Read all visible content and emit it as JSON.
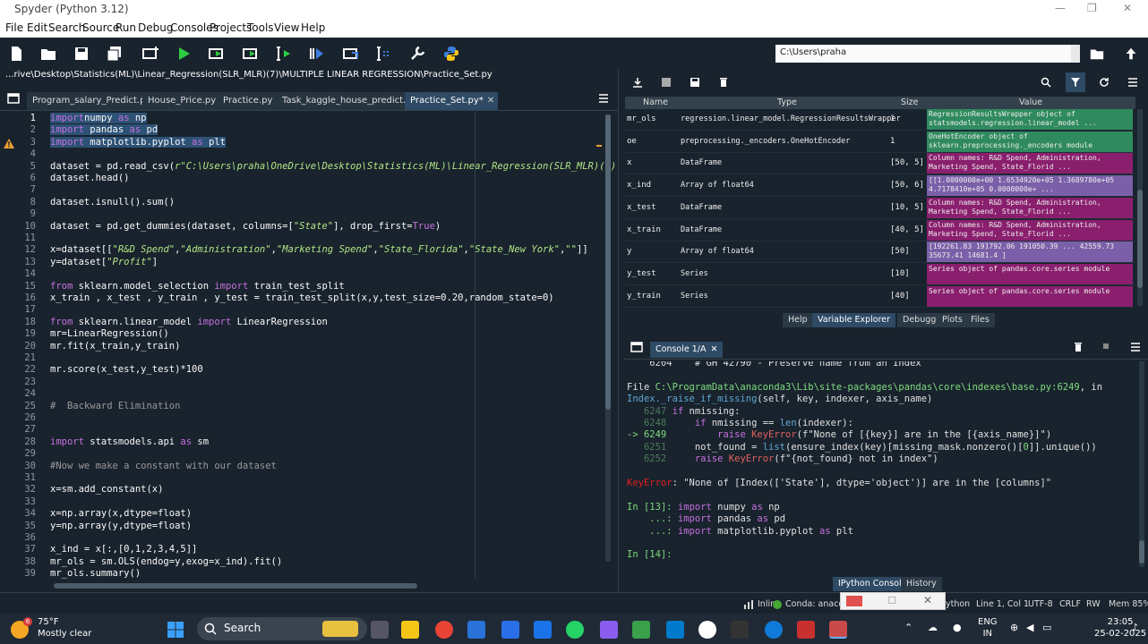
{
  "window": {
    "title": "Spyder (Python 3.12)",
    "minimize": "—",
    "maximize": "❐",
    "close": "✕"
  },
  "menu": [
    "File",
    "Edit",
    "Search",
    "Source",
    "Run",
    "Debug",
    "Consoles",
    "Projects",
    "Tools",
    "View",
    "Help"
  ],
  "toolbar": {
    "working_dir": "C:\\Users\\praha"
  },
  "editor": {
    "file_path": "...rive\\Desktop\\Statistics(ML)\\Linear_Regression(SLR_MLR)(7)\\MULTIPLE LINEAR REGRESSION\\Practice_Set.py",
    "tabs": [
      {
        "label": "Program_salary_Predict.py"
      },
      {
        "label": "House_Price.py"
      },
      {
        "label": "Practice.py"
      },
      {
        "label": "Task_kaggle_house_predict.py"
      },
      {
        "label": "Practice_Set.py*"
      }
    ],
    "lines": [
      {
        "n": "1",
        "segs": [
          [
            "kw",
            "import"
          ],
          [
            "",
            "numpy "
          ],
          [
            "kw",
            "as"
          ],
          [
            "",
            " np"
          ]
        ],
        "sel": true
      },
      {
        "n": "2",
        "segs": [
          [
            "kw",
            "import"
          ],
          [
            "",
            " pandas "
          ],
          [
            "kw",
            "as"
          ],
          [
            "",
            " pd"
          ]
        ],
        "sel": true
      },
      {
        "n": "3",
        "segs": [
          [
            "kw",
            "import"
          ],
          [
            "",
            " matplotlib.pyplot "
          ],
          [
            "kw",
            "as"
          ],
          [
            "",
            " plt"
          ]
        ],
        "sel": true
      },
      {
        "n": "4",
        "segs": []
      },
      {
        "n": "5",
        "segs": [
          [
            "",
            "dataset = pd.read_csv("
          ],
          [
            "st",
            "r\"C:\\Users\\praha\\OneDrive\\Desktop\\Statistics(ML)\\Linear_Regression(SLR_MLR)(7)\\"
          ]
        ]
      },
      {
        "n": "6",
        "segs": [
          [
            "",
            "dataset.head()"
          ]
        ]
      },
      {
        "n": "7",
        "segs": []
      },
      {
        "n": "8",
        "segs": [
          [
            "",
            "dataset.isnull().sum()"
          ]
        ]
      },
      {
        "n": "9",
        "segs": []
      },
      {
        "n": "10",
        "segs": [
          [
            "",
            "dataset = pd.get_dummies(dataset, columns=["
          ],
          [
            "st",
            "\"State\""
          ],
          [
            "",
            "], drop_first="
          ],
          [
            "kw",
            "True"
          ],
          [
            "",
            ")"
          ]
        ]
      },
      {
        "n": "11",
        "segs": []
      },
      {
        "n": "12",
        "segs": [
          [
            "",
            "x=dataset[["
          ],
          [
            "st",
            "\"R&D Spend\""
          ],
          [
            "",
            ","
          ],
          [
            "st",
            "\"Administration\""
          ],
          [
            "",
            ","
          ],
          [
            "st",
            "\"Marketing Spend\""
          ],
          [
            "",
            ","
          ],
          [
            "st",
            "\"State_Florida\""
          ],
          [
            "",
            ","
          ],
          [
            "st",
            "\"State_New York\""
          ],
          [
            "",
            ","
          ],
          [
            "st",
            "\"\""
          ],
          [
            "",
            "]]"
          ]
        ]
      },
      {
        "n": "13",
        "segs": [
          [
            "",
            "y=dataset["
          ],
          [
            "st",
            "\"Profit\""
          ],
          [
            "",
            "]"
          ]
        ]
      },
      {
        "n": "14",
        "segs": []
      },
      {
        "n": "15",
        "segs": [
          [
            "kw",
            "from"
          ],
          [
            "",
            " sklearn.model_selection "
          ],
          [
            "kw",
            "import"
          ],
          [
            "",
            " train_test_split"
          ]
        ]
      },
      {
        "n": "16",
        "segs": [
          [
            "",
            "x_train , x_test , y_train , y_test = train_test_split(x,y,test_size=0.20,random_state=0)"
          ]
        ]
      },
      {
        "n": "17",
        "segs": []
      },
      {
        "n": "18",
        "segs": [
          [
            "kw",
            "from"
          ],
          [
            "",
            " sklearn.linear_model "
          ],
          [
            "kw",
            "import"
          ],
          [
            "",
            " LinearRegression"
          ]
        ]
      },
      {
        "n": "19",
        "segs": [
          [
            "",
            "mr=LinearRegression()"
          ]
        ]
      },
      {
        "n": "20",
        "segs": [
          [
            "",
            "mr.fit(x_train,y_train)"
          ]
        ]
      },
      {
        "n": "21",
        "segs": []
      },
      {
        "n": "22",
        "segs": [
          [
            "",
            "mr.score(x_test,y_test)*100"
          ]
        ]
      },
      {
        "n": "23",
        "segs": []
      },
      {
        "n": "24",
        "segs": []
      },
      {
        "n": "25",
        "segs": [
          [
            "cm",
            "#  Backward Elimination"
          ]
        ]
      },
      {
        "n": "26",
        "segs": []
      },
      {
        "n": "27",
        "segs": []
      },
      {
        "n": "28",
        "segs": [
          [
            "kw",
            "import"
          ],
          [
            "",
            " statsmodels.api "
          ],
          [
            "kw",
            "as"
          ],
          [
            "",
            " sm"
          ]
        ]
      },
      {
        "n": "29",
        "segs": []
      },
      {
        "n": "30",
        "segs": [
          [
            "cm",
            "#Now we make a constant with our dataset"
          ]
        ]
      },
      {
        "n": "31",
        "segs": []
      },
      {
        "n": "32",
        "segs": [
          [
            "",
            "x=sm.add_constant(x)"
          ]
        ]
      },
      {
        "n": "33",
        "segs": []
      },
      {
        "n": "34",
        "segs": [
          [
            "",
            "x=np.array(x,dtype=float)"
          ]
        ]
      },
      {
        "n": "35",
        "segs": [
          [
            "",
            "y=np.array(y,dtype=float)"
          ]
        ]
      },
      {
        "n": "36",
        "segs": []
      },
      {
        "n": "37",
        "segs": [
          [
            "",
            "x_ind = x[:,[0,1,2,3,4,5]]"
          ]
        ]
      },
      {
        "n": "38",
        "segs": [
          [
            "",
            "mr_ols = sm.OLS(endog=y,exog=x_ind).fit()"
          ]
        ]
      },
      {
        "n": "39",
        "segs": [
          [
            "",
            "mr_ols.summary()"
          ]
        ]
      }
    ]
  },
  "variable_explorer": {
    "headers": {
      "name": "Name",
      "type": "Type",
      "size": "Size",
      "value": "Value"
    },
    "rows": [
      {
        "name": "mr_ols",
        "type": "regression.linear_model.RegressionResultsWrapper",
        "size": "1",
        "value": "RegressionResultsWrapper object of statsmodels.regression.linear_model ...",
        "color": "#2f8a5f"
      },
      {
        "name": "oe",
        "type": "preprocessing._encoders.OneHotEncoder",
        "size": "1",
        "value": "OneHotEncoder object of sklearn.preprocessing._encoders module",
        "color": "#2f8a5f"
      },
      {
        "name": "x",
        "type": "DataFrame",
        "size": "[50, 5]",
        "value": "Column names: R&D Spend, Administration, Marketing Spend, State_Florid ...",
        "color": "#8a1f6e"
      },
      {
        "name": "x_ind",
        "type": "Array of float64",
        "size": "[50, 6]",
        "value": "[[1.0000000e+00 1.6534920e+05 1.3689780e+05 4.7178410e+05 0.0000000e+ ...",
        "color": "#7b5fa8"
      },
      {
        "name": "x_test",
        "type": "DataFrame",
        "size": "[10, 5]",
        "value": "Column names: R&D Spend, Administration, Marketing Spend, State_Florid ...",
        "color": "#8a1f6e"
      },
      {
        "name": "x_train",
        "type": "DataFrame",
        "size": "[40, 5]",
        "value": "Column names: R&D Spend, Administration, Marketing Spend, State_Florid ...",
        "color": "#8a1f6e"
      },
      {
        "name": "y",
        "type": "Array of float64",
        "size": "[50]",
        "value": "[192261.83 191792.06 191050.39 ...  42559.73  35673.41  14681.4 ]",
        "color": "#7b5fa8"
      },
      {
        "name": "y_test",
        "type": "Series",
        "size": "[10]",
        "value": "Series object of pandas.core.series module",
        "color": "#8a1f6e"
      },
      {
        "name": "y_train",
        "type": "Series",
        "size": "[40]",
        "value": "Series object of pandas.core.series module",
        "color": "#8a1f6e"
      }
    ],
    "pane_tabs": [
      "Help",
      "Variable Explorer",
      "Debugger",
      "Plots",
      "Files"
    ],
    "active_pane_tab": 1
  },
  "console": {
    "tab": "Console 1/A",
    "lines": [
      {
        "segs": [
          [
            "#d9d9d9",
            "    6204    "
          ],
          [
            "#e0e0e0",
            "# GH 42790 - Preserve name from an Index"
          ]
        ]
      },
      {
        "segs": []
      },
      {
        "segs": [
          [
            "#e0e0e0",
            "File "
          ],
          [
            "#7fdc7f",
            "C:\\ProgramData\\anaconda3\\Lib\\site-packages\\pandas\\core\\indexes\\base.py:6249"
          ],
          [
            "#e0e0e0",
            ", in"
          ]
        ]
      },
      {
        "segs": [
          [
            "#5fa8d3",
            "Index._raise_if_missing"
          ],
          [
            "#e0e0e0",
            "(self, key, indexer, axis_name)"
          ]
        ]
      },
      {
        "segs": [
          [
            "#4a7a5a",
            "   6247 "
          ],
          [
            "#c670e0",
            "if"
          ],
          [
            "#e0e0e0",
            " nmissing:"
          ]
        ]
      },
      {
        "segs": [
          [
            "#4a7a5a",
            "   6248     "
          ],
          [
            "#c670e0",
            "if"
          ],
          [
            "#e0e0e0",
            " nmissing == "
          ],
          [
            "#5fa8d3",
            "len"
          ],
          [
            "#e0e0e0",
            "(indexer):"
          ]
        ]
      },
      {
        "segs": [
          [
            "#7fdc7f",
            "-> 6249         "
          ],
          [
            "#c670e0",
            "raise"
          ],
          [
            "#e0e0e0",
            " "
          ],
          [
            "#e06060",
            "KeyError"
          ],
          [
            "#e0e0e0",
            "("
          ],
          [
            "#e0e0e0",
            "f\"None of [{key}] are in the [{axis_name}]\""
          ],
          [
            "#e0e0e0",
            ")"
          ]
        ]
      },
      {
        "segs": [
          [
            "#4a7a5a",
            "   6251     "
          ],
          [
            "#e0e0e0",
            "not_found = "
          ],
          [
            "#5fa8d3",
            "list"
          ],
          [
            "#e0e0e0",
            "(ensure_index(key)[missing_mask.nonzero()["
          ],
          [
            "#7fdc7f",
            "0"
          ],
          [
            "#e0e0e0",
            "]].unique())"
          ]
        ]
      },
      {
        "segs": [
          [
            "#4a7a5a",
            "   6252     "
          ],
          [
            "#c670e0",
            "raise"
          ],
          [
            "#e0e0e0",
            " "
          ],
          [
            "#e06060",
            "KeyError"
          ],
          [
            "#e0e0e0",
            "(f\"{not_found} not in index\")"
          ]
        ]
      },
      {
        "segs": []
      },
      {
        "segs": [
          [
            "#e02020",
            "KeyError"
          ],
          [
            "#e0e0e0",
            ": \"None of [Index(['State'], dtype='object')] are in the [columns]\""
          ]
        ]
      },
      {
        "segs": []
      },
      {
        "segs": [
          [
            "#7fdc7f",
            "In ["
          ],
          [
            "#7fdc7f",
            "13"
          ],
          [
            "#7fdc7f",
            "]: "
          ],
          [
            "#c670e0",
            "import"
          ],
          [
            "#e0e0e0",
            " numpy "
          ],
          [
            "#c670e0",
            "as"
          ],
          [
            "#e0e0e0",
            " np"
          ]
        ]
      },
      {
        "segs": [
          [
            "#7fdc7f",
            "    ...: "
          ],
          [
            "#c670e0",
            "import"
          ],
          [
            "#e0e0e0",
            " pandas "
          ],
          [
            "#c670e0",
            "as"
          ],
          [
            "#e0e0e0",
            " pd"
          ]
        ]
      },
      {
        "segs": [
          [
            "#7fdc7f",
            "    ...: "
          ],
          [
            "#c670e0",
            "import"
          ],
          [
            "#e0e0e0",
            " matplotlib.pyplot "
          ],
          [
            "#c670e0",
            "as"
          ],
          [
            "#e0e0e0",
            " plt"
          ]
        ]
      },
      {
        "segs": []
      },
      {
        "segs": [
          [
            "#7fdc7f",
            "In [14]:"
          ]
        ]
      }
    ],
    "bottom_tabs": [
      "IPython Console",
      "History"
    ]
  },
  "status": {
    "inline": "Inline",
    "conda": "Conda: anacon",
    "python": "ython",
    "position": "Line 1, Col 1",
    "encoding": "UTF-8",
    "eol": "CRLF",
    "rw": "RW",
    "mem": "Mem 85%"
  },
  "taskbar": {
    "temp": "75°F",
    "weather": "Mostly clear",
    "badge": "6",
    "search": "Search",
    "lang1": "ENG",
    "lang2": "IN",
    "time": "23:05",
    "date": "25-02-2025"
  }
}
